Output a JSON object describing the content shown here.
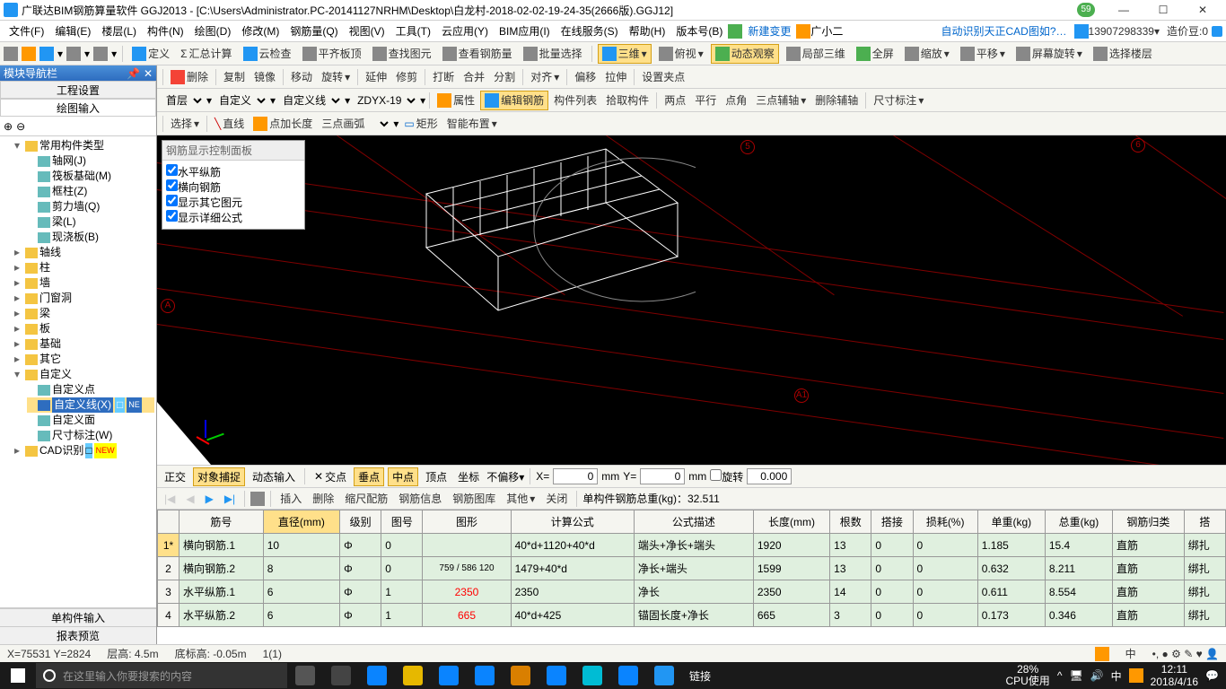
{
  "title": "广联达BIM钢筋算量软件 GGJ2013 - [C:\\Users\\Administrator.PC-20141127NRHM\\Desktop\\白龙村-2018-02-02-19-24-35(2666版).GGJ12]",
  "badge": "59",
  "menu": [
    "文件(F)",
    "编辑(E)",
    "楼层(L)",
    "构件(N)",
    "绘图(D)",
    "修改(M)",
    "钢筋量(Q)",
    "视图(V)",
    "工具(T)",
    "云应用(Y)",
    "BIM应用(I)",
    "在线服务(S)",
    "帮助(H)",
    "版本号(B)"
  ],
  "menuRight": {
    "newChange": "新建变更",
    "guangxiao": "广小二",
    "autoRec": "自动识别天正CAD图如?…",
    "phone": "13907298339",
    "zaojia": "造价豆:0"
  },
  "tb1": [
    "定义",
    "汇总计算",
    "云检查",
    "平齐板顶",
    "查找图元",
    "查看钢筋量",
    "批量选择"
  ],
  "tb1r": [
    "三维",
    "俯视",
    "动态观察",
    "局部三维",
    "全屏",
    "缩放",
    "平移",
    "屏幕旋转",
    "选择楼层"
  ],
  "ribEdit": [
    "删除",
    "复制",
    "镜像",
    "移动",
    "旋转",
    "延伸",
    "修剪",
    "打断",
    "合并",
    "分割",
    "对齐",
    "偏移",
    "拉伸",
    "设置夹点"
  ],
  "rib2": {
    "floor": "首层",
    "cat": "自定义",
    "sub": "自定义线",
    "code": "ZDYX-19",
    "attr": "属性",
    "edit": "编辑钢筋",
    "list": "构件列表",
    "pick": "拾取构件",
    "two": "两点",
    "parallel": "平行",
    "angle": "点角",
    "three": "三点辅轴",
    "delaux": "删除辅轴",
    "dim": "尺寸标注"
  },
  "rib3": {
    "select": "选择",
    "line": "直线",
    "addlen": "点加长度",
    "arc3": "三点画弧",
    "rect": "矩形",
    "smart": "智能布置"
  },
  "nav": {
    "title": "模块导航栏",
    "tab1": "工程设置",
    "tab2": "绘图输入"
  },
  "tree": {
    "root": "常用构件类型",
    "items": [
      "轴网(J)",
      "筏板基础(M)",
      "框柱(Z)",
      "剪力墙(Q)",
      "梁(L)",
      "现浇板(B)"
    ],
    "folders": [
      "轴线",
      "柱",
      "墙",
      "门窗洞",
      "梁",
      "板",
      "基础",
      "其它"
    ],
    "custom": "自定义",
    "customItems": [
      "自定义点",
      "自定义线(X)",
      "自定义面",
      "尺寸标注(W)"
    ],
    "cad": "CAD识别"
  },
  "btmTabs": [
    "单构件输入",
    "报表预览"
  ],
  "floatPanel": {
    "title": "钢筋显示控制面板",
    "items": [
      "水平纵筋",
      "横向钢筋",
      "显示其它图元",
      "显示详细公式"
    ]
  },
  "snap": {
    "ortho": "正交",
    "osnap": "对象捕捉",
    "dyn": "动态输入",
    "cross": "交点",
    "perp": "垂点",
    "mid": "中点",
    "peak": "顶点",
    "coord": "坐标",
    "nooffset": "不偏移",
    "x": "X=",
    "xval": "0",
    "mm": "mm",
    "y": "Y=",
    "yval": "0",
    "rot": "旋转",
    "rotval": "0.000"
  },
  "editbar": {
    "insert": "插入",
    "delete": "删除",
    "scale": "缩尺配筋",
    "info": "钢筋信息",
    "lib": "钢筋图库",
    "other": "其他",
    "close": "关闭",
    "total": "单构件钢筋总重(kg)：32.511"
  },
  "table": {
    "headers": [
      "",
      "筋号",
      "直径(mm)",
      "级别",
      "图号",
      "图形",
      "计算公式",
      "公式描述",
      "长度(mm)",
      "根数",
      "搭接",
      "损耗(%)",
      "单重(kg)",
      "总重(kg)",
      "钢筋归类",
      "搭"
    ],
    "rows": [
      {
        "n": "1*",
        "name": "横向钢筋.1",
        "dia": "10",
        "lvl": "Φ",
        "code": "0",
        "formula": "40*d+1120+40*d",
        "desc": "端头+净长+端头",
        "len": "1920",
        "cnt": "13",
        "lap": "0",
        "loss": "0",
        "uw": "1.185",
        "tw": "15.4",
        "cat": "直筋",
        "sp": "绑扎"
      },
      {
        "n": "2",
        "name": "横向钢筋.2",
        "dia": "8",
        "lvl": "Φ",
        "code": "0",
        "shape": "759 / 586  120",
        "formula": "1479+40*d",
        "desc": "净长+端头",
        "len": "1599",
        "cnt": "13",
        "lap": "0",
        "loss": "0",
        "uw": "0.632",
        "tw": "8.211",
        "cat": "直筋",
        "sp": "绑扎"
      },
      {
        "n": "3",
        "name": "水平纵筋.1",
        "dia": "6",
        "lvl": "Φ",
        "code": "1",
        "shape": "2350",
        "formula": "2350",
        "desc": "净长",
        "len": "2350",
        "cnt": "14",
        "lap": "0",
        "loss": "0",
        "uw": "0.611",
        "tw": "8.554",
        "cat": "直筋",
        "sp": "绑扎"
      },
      {
        "n": "4",
        "name": "水平纵筋.2",
        "dia": "6",
        "lvl": "Φ",
        "code": "1",
        "shape": "665",
        "formula": "40*d+425",
        "desc": "锚固长度+净长",
        "len": "665",
        "cnt": "3",
        "lap": "0",
        "loss": "0",
        "uw": "0.173",
        "tw": "0.346",
        "cat": "直筋",
        "sp": "绑扎"
      }
    ]
  },
  "status": {
    "coord": "X=75531 Y=2824",
    "floor": "层高: 4.5m",
    "bottom": "底标高: -0.05m",
    "count": "1(1)"
  },
  "taskbar": {
    "search": "在这里输入你要搜索的内容",
    "link": "链接",
    "cpu": "28%",
    "cpulbl": "CPU使用",
    "time": "12:11",
    "date": "2018/4/16",
    "ime": "中"
  }
}
